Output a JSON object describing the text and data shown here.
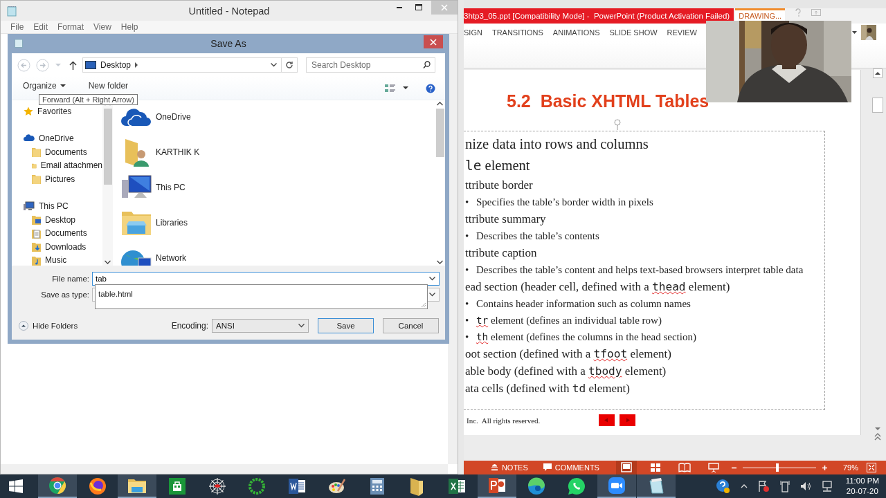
{
  "notepad": {
    "title": "Untitled - Notepad",
    "menu": [
      "File",
      "Edit",
      "Format",
      "View",
      "Help"
    ]
  },
  "save_dialog": {
    "title": "Save As",
    "location": "Desktop",
    "search": {
      "placeholder": "Search Desktop"
    },
    "toolbar": {
      "organize": "Organize",
      "new_folder": "New folder"
    },
    "tooltip": "Forward (Alt + Right Arrow)",
    "nav_tree": [
      {
        "label": "Favorites",
        "kind": "star"
      },
      {
        "label": "OneDrive",
        "kind": "cloud",
        "children": [
          {
            "label": "Documents",
            "kind": "folder"
          },
          {
            "label": "Email attachmen",
            "kind": "folder"
          },
          {
            "label": "Pictures",
            "kind": "folder"
          }
        ]
      },
      {
        "label": "This PC",
        "kind": "pc",
        "children": [
          {
            "label": "Desktop",
            "kind": "desktop"
          },
          {
            "label": "Documents",
            "kind": "documents"
          },
          {
            "label": "Downloads",
            "kind": "downloads"
          },
          {
            "label": "Music",
            "kind": "music"
          }
        ]
      }
    ],
    "items": [
      {
        "label": "OneDrive",
        "kind": "cloud"
      },
      {
        "label": "KARTHIK K",
        "kind": "user"
      },
      {
        "label": "This PC",
        "kind": "pc"
      },
      {
        "label": "Libraries",
        "kind": "library"
      },
      {
        "label": "Network",
        "kind": "network"
      }
    ],
    "file_name": {
      "label": "File name:",
      "value": "tab"
    },
    "suggestions": [
      "table.html"
    ],
    "save_as_type": {
      "label": "Save as type:"
    },
    "hide_folders": "Hide Folders",
    "encoding": {
      "label": "Encoding:",
      "value": "ANSI"
    },
    "buttons": [
      "Save",
      "Cancel"
    ]
  },
  "powerpoint": {
    "title": "3htp3_05.ppt [Compatibility Mode] -  PowerPoint (Product Activation Failed)",
    "context_tab": "DRAWING...",
    "ribbon_tabs": [
      "SIGN",
      "TRANSITIONS",
      "ANIMATIONS",
      "SLIDE SHOW",
      "REVIEW"
    ],
    "slide": {
      "title": "5.2  Basic XHTML Tables",
      "lines": [
        {
          "kind": "l1",
          "parts": [
            {
              "text": "nize data into rows and columns",
              "code": false,
              "flagged": false
            }
          ]
        },
        {
          "kind": "l1",
          "parts": [
            {
              "text": "le",
              "code": true,
              "flagged": false
            },
            {
              "text": " element",
              "code": false,
              "flagged": false
            }
          ]
        },
        {
          "kind": "l2",
          "parts": [
            {
              "text": "ttribute border",
              "code": false,
              "flagged": false
            }
          ]
        },
        {
          "kind": "l3",
          "bullet": "•",
          "parts": [
            {
              "text": "Specifies the table’s border width in pixels",
              "code": false,
              "flagged": false
            }
          ]
        },
        {
          "kind": "l2",
          "parts": [
            {
              "text": "ttribute summary",
              "code": false,
              "flagged": false
            }
          ]
        },
        {
          "kind": "l3",
          "bullet": "•",
          "parts": [
            {
              "text": "Describes the table’s contents",
              "code": false,
              "flagged": false
            }
          ]
        },
        {
          "kind": "l2",
          "parts": [
            {
              "text": "ttribute caption",
              "code": false,
              "flagged": false
            }
          ]
        },
        {
          "kind": "l3",
          "bullet": "•",
          "parts": [
            {
              "text": "Describes the table’s content and helps text-based browsers interpret table data",
              "code": false,
              "flagged": false
            }
          ]
        },
        {
          "kind": "l2",
          "parts": [
            {
              "text": "ead section (header cell, defined with a ",
              "code": false,
              "flagged": false
            },
            {
              "text": "thead",
              "code": true,
              "flagged": true
            },
            {
              "text": " element)",
              "code": false,
              "flagged": false
            }
          ]
        },
        {
          "kind": "l3",
          "bullet": "•",
          "parts": [
            {
              "text": "Contains header information such as column names",
              "code": false,
              "flagged": false
            }
          ]
        },
        {
          "kind": "l3",
          "bullet": "•",
          "parts": [
            {
              "text": "tr",
              "code": true,
              "flagged": true
            },
            {
              "text": " element (defines an individual table row)",
              "code": false,
              "flagged": false
            }
          ]
        },
        {
          "kind": "l3",
          "bullet": "•",
          "parts": [
            {
              "text": "th",
              "code": true,
              "flagged": true
            },
            {
              "text": " element (defines the columns in the head section)",
              "code": false,
              "flagged": false
            }
          ]
        },
        {
          "kind": "l2",
          "parts": [
            {
              "text": "oot section (defined with a ",
              "code": false,
              "flagged": false
            },
            {
              "text": "tfoot",
              "code": true,
              "flagged": true
            },
            {
              "text": " element)",
              "code": false,
              "flagged": false
            }
          ]
        },
        {
          "kind": "l2",
          "parts": [
            {
              "text": "able body (defined with a ",
              "code": false,
              "flagged": false
            },
            {
              "text": "tbody",
              "code": true,
              "flagged": true
            },
            {
              "text": " element)",
              "code": false,
              "flagged": false
            }
          ]
        },
        {
          "kind": "l2",
          "parts": [
            {
              "text": "ata cells (defined with ",
              "code": false,
              "flagged": false
            },
            {
              "text": "td",
              "code": true,
              "flagged": false
            },
            {
              "text": " element)",
              "code": false,
              "flagged": false
            }
          ]
        }
      ],
      "footer": "Inc.  All rights reserved."
    },
    "status": {
      "notes": "NOTES",
      "comments": "COMMENTS",
      "zoom": "79%",
      "zoom_slider": {
        "level": 0.47
      }
    }
  },
  "taskbar": {
    "apps": [
      {
        "kind": "chrome",
        "active": true
      },
      {
        "kind": "firefox",
        "active": false
      },
      {
        "kind": "explorer",
        "active": true
      },
      {
        "kind": "store",
        "active": false
      },
      {
        "kind": "web",
        "active": false
      },
      {
        "kind": "ring",
        "active": false
      },
      {
        "kind": "word",
        "active": false
      },
      {
        "kind": "paint",
        "active": false
      },
      {
        "kind": "calculator",
        "active": false
      },
      {
        "kind": "folder",
        "active": false
      },
      {
        "kind": "excel",
        "active": false
      },
      {
        "kind": "powerpoint",
        "active": true
      },
      {
        "kind": "edge",
        "active": false
      },
      {
        "kind": "whatsapp",
        "active": false
      },
      {
        "kind": "zoom",
        "active": true
      },
      {
        "kind": "notepad",
        "active": true
      }
    ],
    "time": "11:00 PM",
    "date": "20-07-20"
  }
}
